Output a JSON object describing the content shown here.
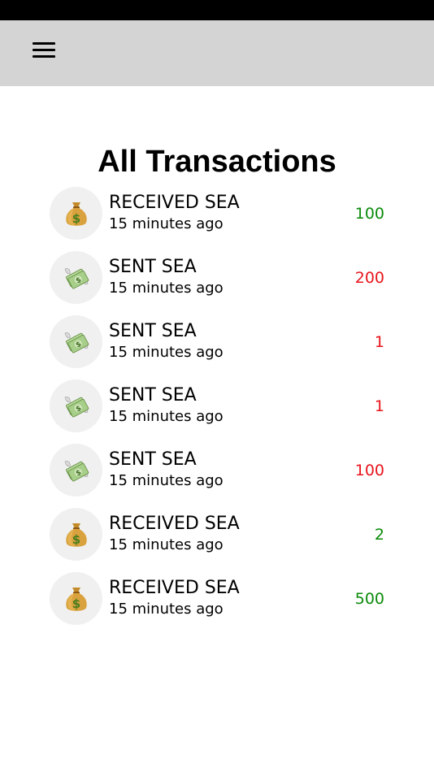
{
  "header": {
    "menu_icon": "hamburger-menu-icon"
  },
  "page": {
    "title": "All Transactions"
  },
  "colors": {
    "received": "#0a8a0a",
    "sent": "#e8141c",
    "nav_background": "#d4d4d4",
    "status_bar": "#000000",
    "avatar_background": "#f0f0f0"
  },
  "transactions": [
    {
      "type": "received",
      "icon": "money-bag-icon",
      "label": "RECEIVED SEA",
      "time": "15 minutes ago",
      "amount": "100"
    },
    {
      "type": "sent",
      "icon": "money-with-wings-icon",
      "label": "SENT SEA",
      "time": "15 minutes ago",
      "amount": "200"
    },
    {
      "type": "sent",
      "icon": "money-with-wings-icon",
      "label": "SENT SEA",
      "time": "15 minutes ago",
      "amount": "1"
    },
    {
      "type": "sent",
      "icon": "money-with-wings-icon",
      "label": "SENT SEA",
      "time": "15 minutes ago",
      "amount": "1"
    },
    {
      "type": "sent",
      "icon": "money-with-wings-icon",
      "label": "SENT SEA",
      "time": "15 minutes ago",
      "amount": "100"
    },
    {
      "type": "received",
      "icon": "money-bag-icon",
      "label": "RECEIVED SEA",
      "time": "15 minutes ago",
      "amount": "2"
    },
    {
      "type": "received",
      "icon": "money-bag-icon",
      "label": "RECEIVED SEA",
      "time": "15 minutes ago",
      "amount": "500"
    }
  ]
}
